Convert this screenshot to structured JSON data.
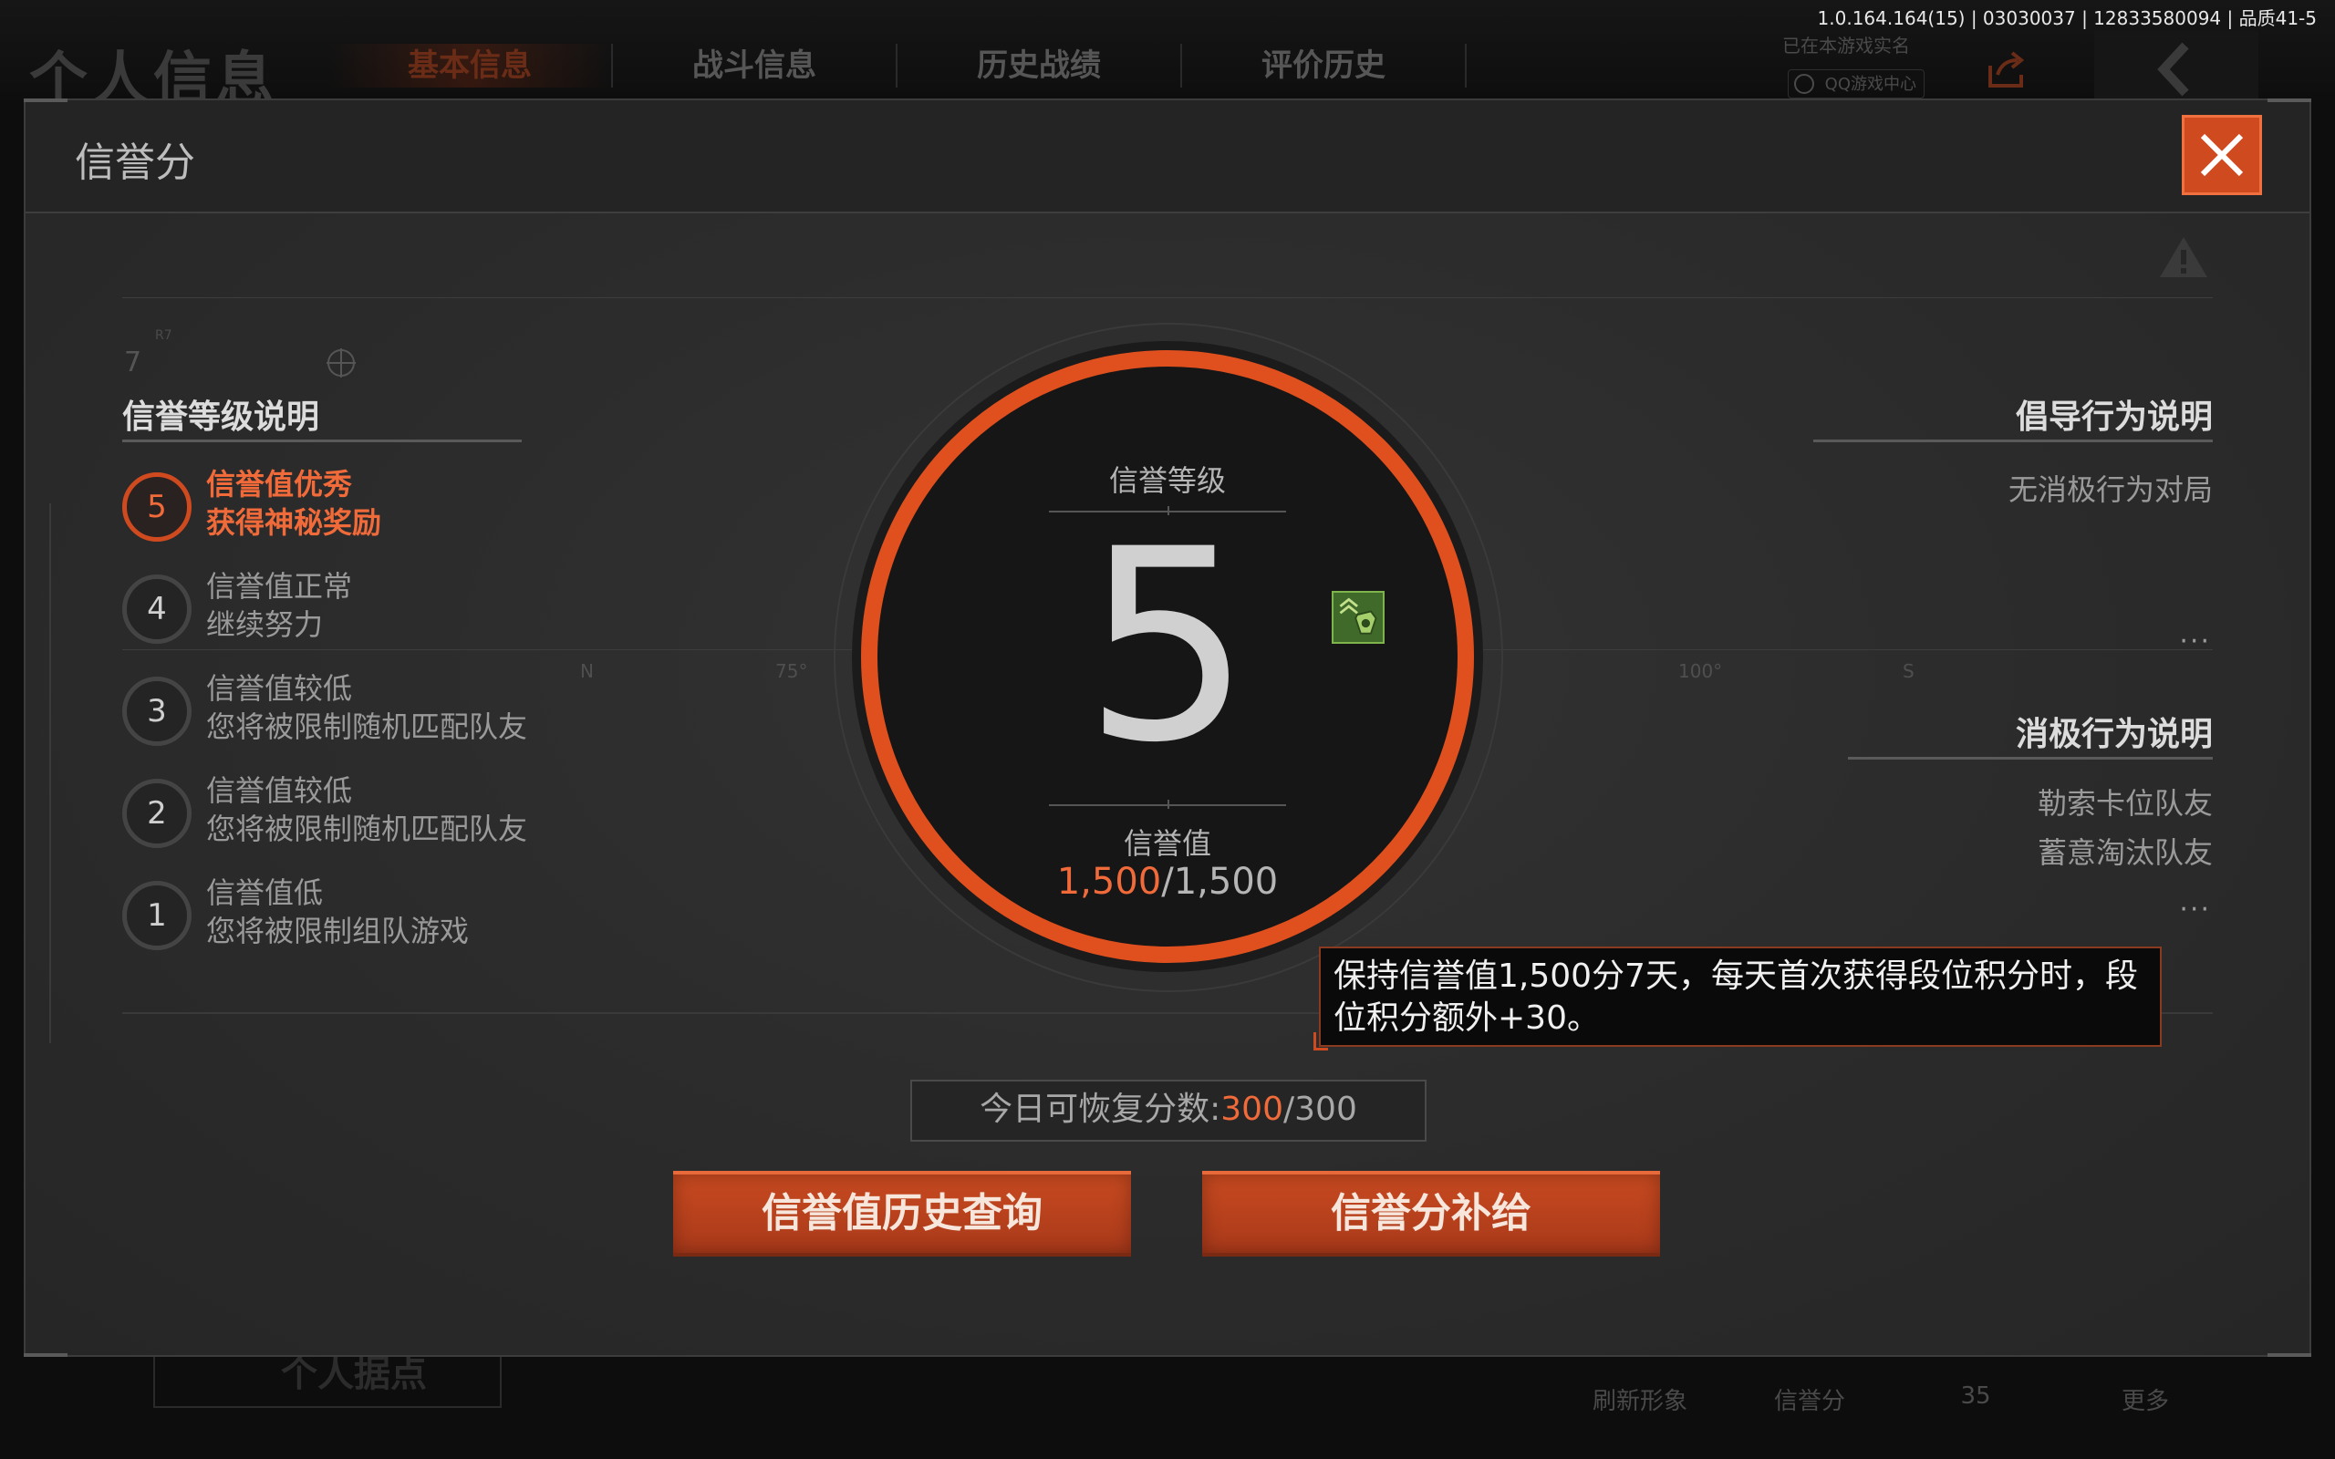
{
  "version": "1.0.164.164(15) | 03030037 | 12833580094 | 品质41-5",
  "background": {
    "title": "个人信息",
    "tabs": [
      "基本信息",
      "战斗信息",
      "历史战绩",
      "评价历史"
    ],
    "realname": "已在本游戏实名",
    "qq_center": "QQ游戏中心",
    "home_button": "个人据点",
    "bottom_nav": [
      "刷新形象",
      "信誉分",
      "35",
      "更多"
    ]
  },
  "dialog": {
    "title": "信誉分",
    "levels_title": "信誉等级说明",
    "levels": [
      {
        "num": "5",
        "line1": "信誉值优秀",
        "line2": "获得神秘奖励",
        "active": true
      },
      {
        "num": "4",
        "line1": "信誉值正常",
        "line2": "继续努力",
        "active": false
      },
      {
        "num": "3",
        "line1": "信誉值较低",
        "line2": "您将被限制随机匹配队友",
        "active": false
      },
      {
        "num": "2",
        "line1": "信誉值较低",
        "line2": "您将被限制随机匹配队友",
        "active": false
      },
      {
        "num": "1",
        "line1": "信誉值低",
        "line2": "您将被限制组队游戏",
        "active": false
      }
    ],
    "level_label": "信誉等级",
    "level_value": "5",
    "score_label": "信誉值",
    "score_current": "1,500",
    "score_max": "/1,500",
    "encourage_title": "倡导行为说明",
    "encourage_items": [
      "无消极行为对局"
    ],
    "negative_title": "消极行为说明",
    "negative_items": [
      "勒索卡位队友",
      "蓄意淘汰队友"
    ],
    "more": "···",
    "tooltip": "保持信誉值1,500分7天，每天首次获得段位积分时，段位积分额外+30。",
    "recovery_label": "今日可恢复分数:",
    "recovery_current": "300",
    "recovery_max": "/300",
    "history_button": "信誉值历史查询",
    "supply_button": "信誉分补给",
    "scale_labels": [
      "N",
      "75°",
      "100°",
      "S"
    ],
    "decor_num": "7",
    "decor_small": "R7"
  },
  "colors": {
    "accent": "#e0501f",
    "badge": "#3f6a2a"
  }
}
